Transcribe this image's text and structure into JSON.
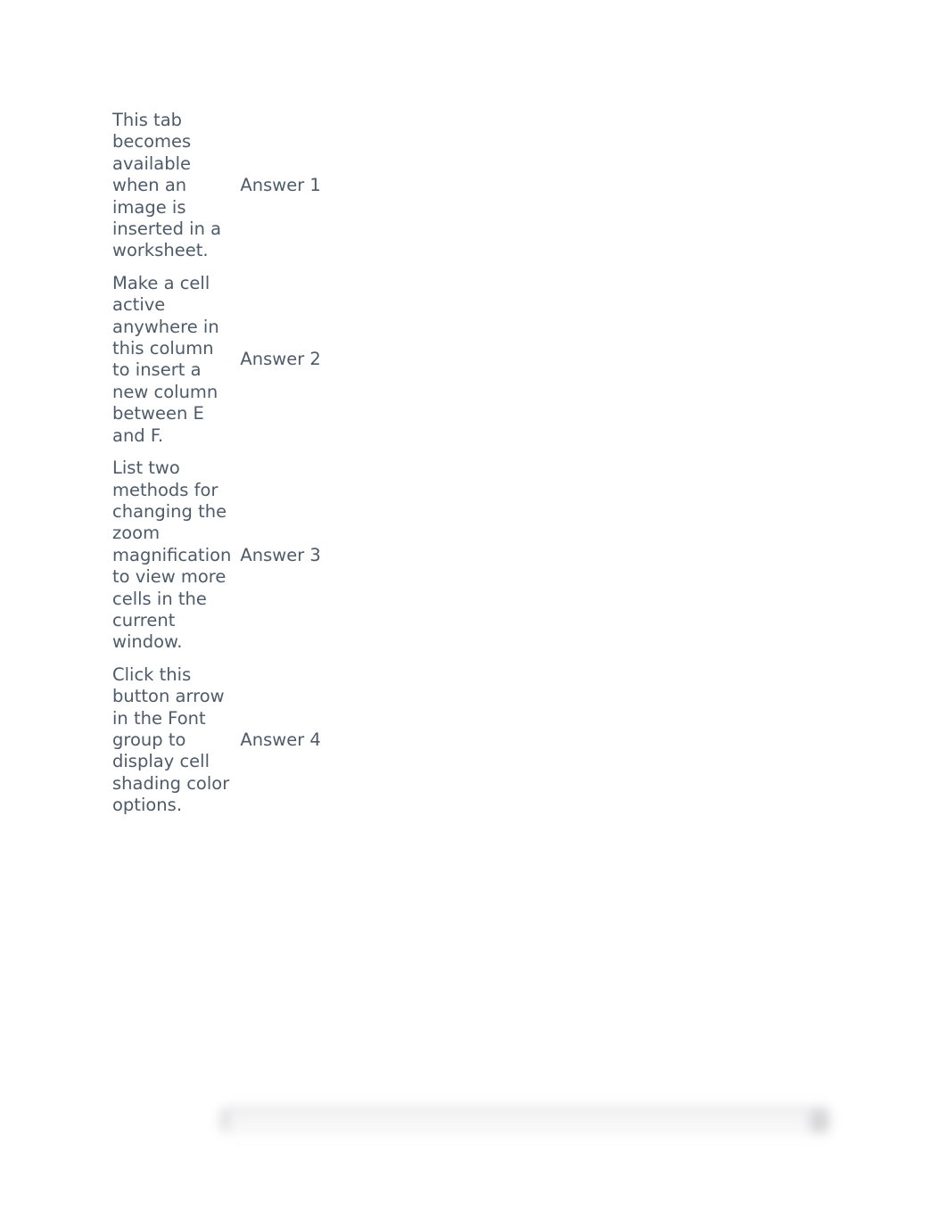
{
  "questions": [
    {
      "prompt": "This tab becomes available when an image is inserted in a worksheet.",
      "answer_label": "Answer 1"
    },
    {
      "prompt": "Make a cell active anywhere in this column to insert a new column between E and F.",
      "answer_label": "Answer 2"
    },
    {
      "prompt": "List two methods for changing the zoom magnification to view more cells in the current window.",
      "answer_label": "Answer 3"
    },
    {
      "prompt": "Click this button arrow in the Font group to display cell shading color options.",
      "answer_label": "Answer 4"
    }
  ],
  "colors": {
    "text": "#4d5b6a",
    "background": "#ffffff"
  }
}
